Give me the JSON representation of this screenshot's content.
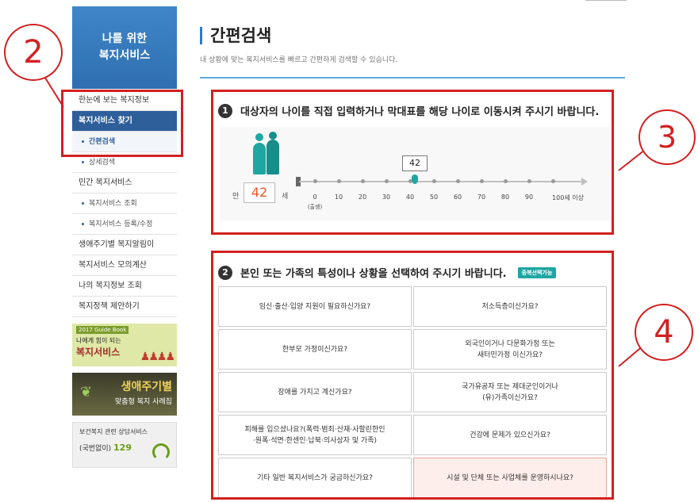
{
  "sidebar": {
    "hero_line1": "나를 위한",
    "hero_line2": "복지서비스",
    "menu": [
      {
        "label": "한눈에 보는 복지정보",
        "type": "main"
      },
      {
        "label": "복지서비스 찾기",
        "type": "active"
      },
      {
        "label": "간편검색",
        "type": "sub-current"
      },
      {
        "label": "상세검색",
        "type": "sub"
      },
      {
        "label": "민간 복지서비스",
        "type": "main"
      },
      {
        "label": "복지서비스 조회",
        "type": "sub"
      },
      {
        "label": "복지서비스 등록/수정",
        "type": "sub"
      },
      {
        "label": "생애주기별 복지알림이",
        "type": "main"
      },
      {
        "label": "복지서비스 모의계산",
        "type": "main"
      },
      {
        "label": "나의 복지정보 조회",
        "type": "main"
      },
      {
        "label": "복지정책 제안하기",
        "type": "main"
      }
    ],
    "banner1": {
      "tag": "2017 Guide Book",
      "line1": "나에게 힘이 되는",
      "line2": "복지서비스"
    },
    "banner2": {
      "line1": "생애주기별",
      "line2": "맞춤형 복지 사례집"
    },
    "banner3": {
      "line1": "보건복지 관련 상담서비스",
      "line2_prefix": "(국번없이)",
      "line2_number": "129"
    }
  },
  "main": {
    "title": "간편검색",
    "description": "내 상황에 맞는 복지서비스를 빠르고 간편하게 검색할 수 있습니다.",
    "step1": {
      "number": "1",
      "heading": "대상자의 나이를 직접 입력하거나 막대표를 해당 나이로 이동시켜 주시기 바랍니다.",
      "age_prefix": "만",
      "age_value": "42",
      "age_unit": "세",
      "bubble_value": "42",
      "ticks": [
        "0",
        "10",
        "20",
        "30",
        "40",
        "50",
        "60",
        "70",
        "80",
        "90",
        "100세 이상"
      ],
      "tick0_sub": "(출생)"
    },
    "step2": {
      "number": "2",
      "heading": "본인 또는 가족의 특성이나 상황을 선택하여 주시기 바랍니다.",
      "badge": "중복선택가능",
      "options": [
        "임신·출산·입양 지원이 필요하신가요?",
        "저소득층이신가요?",
        "한부모 가정이신가요?",
        "외국인이거나 다문화가정 또는\n새터민가정 이신가요?",
        "장애를 가지고 계신가요?",
        "국가유공자 또는 제대군인이거나\n(유)가족이신가요?",
        "피해를 입으셨나요?(폭력·범죄·산재·사할린한인\n·원폭·석면·한센인·납북·의사상자 및 가족)",
        "건강에 문제가 있으신가요?",
        "기타 일반 복지서비스가 궁금하신가요?",
        "시설 및 단체 또는 사업체를 운영하시나요?"
      ]
    }
  },
  "annotations": [
    "2",
    "3",
    "4"
  ],
  "colors": {
    "accent": "#2e79c8",
    "teal": "#1fa6a2",
    "annotation": "#d32020",
    "age": "#e8552a"
  }
}
